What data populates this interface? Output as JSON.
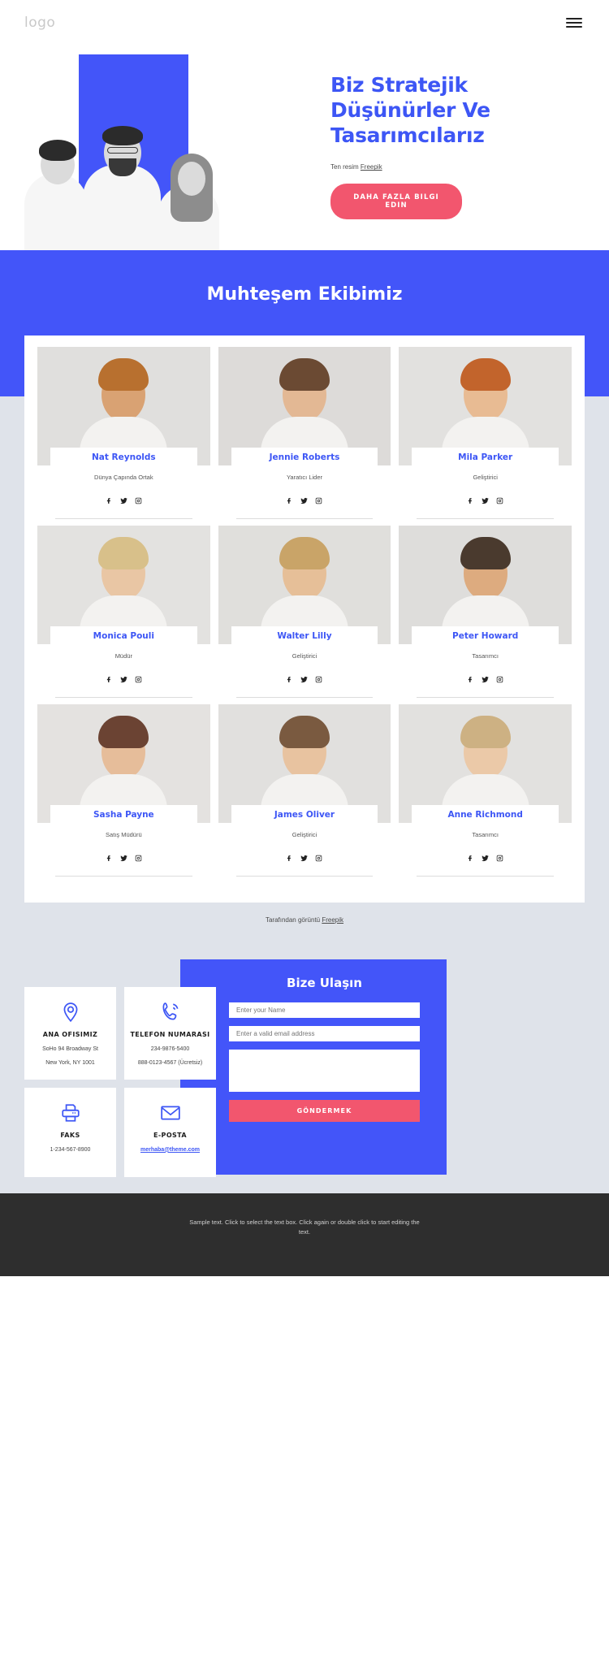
{
  "header": {
    "logo": "logo",
    "menu_icon": "hamburger-icon"
  },
  "hero": {
    "title_line1": "Biz Stratejik",
    "title_line2": "Düşünürler Ve",
    "title_line3": "Tasarımcılarız",
    "credit_prefix": "Ten resim ",
    "credit_link": "Freepik",
    "cta_label": "DAHA FAZLA BILGI EDIN"
  },
  "team": {
    "heading": "Muhteşem Ekibimiz",
    "credit_prefix": "Tarafından görüntü ",
    "credit_link": "Freepik",
    "members": [
      {
        "name": "Nat Reynolds",
        "role": "Dünya Çapında Ortak"
      },
      {
        "name": "Jennie Roberts",
        "role": "Yaratıcı Lider"
      },
      {
        "name": "Mila Parker",
        "role": "Geliştirici"
      },
      {
        "name": "Monica Pouli",
        "role": "Müdür"
      },
      {
        "name": "Walter Lilly",
        "role": "Geliştirici"
      },
      {
        "name": "Peter Howard",
        "role": "Tasarımcı"
      },
      {
        "name": "Sasha Payne",
        "role": "Satış Müdürü"
      },
      {
        "name": "James Oliver",
        "role": "Geliştirici"
      },
      {
        "name": "Anne Richmond",
        "role": "Tasarımcı"
      }
    ],
    "social_icons": [
      "facebook-icon",
      "twitter-icon",
      "instagram-icon"
    ]
  },
  "contact": {
    "cards": [
      {
        "icon": "location-pin-icon",
        "title": "ANA OFISIMIZ",
        "lines": [
          "SoHo 94 Broadway St",
          "New York, NY 1001"
        ],
        "is_link": false
      },
      {
        "icon": "phone-icon",
        "title": "TELEFON NUMARASI",
        "lines": [
          "234-9876-5400",
          "888-0123-4567 (Ücretsiz)"
        ],
        "is_link": false
      },
      {
        "icon": "printer-icon",
        "title": "FAKS",
        "lines": [
          "1-234-567-8900"
        ],
        "is_link": false
      },
      {
        "icon": "envelope-icon",
        "title": "E-POSTA",
        "lines": [
          "merhaba@theme.com"
        ],
        "is_link": true
      }
    ],
    "form": {
      "title": "Bize Ulaşın",
      "name_placeholder": "Enter your Name",
      "name_value": "",
      "email_placeholder": "Enter a valid email address",
      "email_value": "",
      "message_placeholder": "",
      "message_value": "",
      "submit_label": "GÖNDERMEK"
    }
  },
  "footer": {
    "text": "Sample text. Click to select the text box. Click again or double click to start editing the text."
  },
  "colors": {
    "brand_blue": "#4355f9",
    "accent_pink": "#f2566e",
    "section_bg": "#dfe3ea",
    "footer_bg": "#2e2e2e"
  }
}
